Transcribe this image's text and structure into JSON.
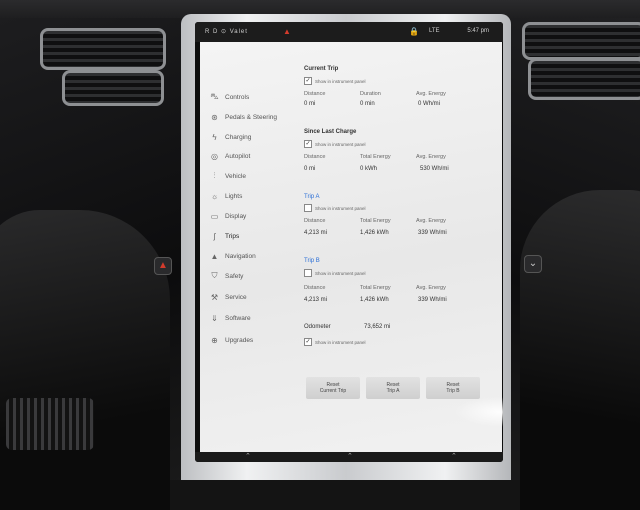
{
  "status_bar": {
    "left_text": "R D ⊙ Valet",
    "network": "LTE",
    "time": "5:47 pm"
  },
  "sidebar": {
    "items": [
      {
        "label": "Controls",
        "icon": "car-icon"
      },
      {
        "label": "Pedals & Steering",
        "icon": "steering-wheel-icon"
      },
      {
        "label": "Charging",
        "icon": "lightning-icon"
      },
      {
        "label": "Autopilot",
        "icon": "steering-circle-icon"
      },
      {
        "label": "Vehicle",
        "icon": "sliders-icon"
      },
      {
        "label": "Lights",
        "icon": "sun-icon"
      },
      {
        "label": "Display",
        "icon": "display-icon"
      },
      {
        "label": "Trips",
        "icon": "trips-icon"
      },
      {
        "label": "Navigation",
        "icon": "navigation-arrow-icon"
      },
      {
        "label": "Safety",
        "icon": "shield-icon"
      },
      {
        "label": "Service",
        "icon": "wrench-icon"
      },
      {
        "label": "Software",
        "icon": "download-icon"
      },
      {
        "label": "Upgrades",
        "icon": "upgrade-icon"
      }
    ]
  },
  "current_trip": {
    "title": "Current Trip",
    "show_label": "Show in instrument panel",
    "distance_label": "Distance",
    "distance": "0 mi",
    "duration_label": "Duration",
    "duration": "0 min",
    "energy_label": "Avg. Energy",
    "energy": "0 Wh/mi"
  },
  "since_last_charge": {
    "title": "Since Last Charge",
    "show_label": "Show in instrument panel",
    "distance_label": "Distance",
    "distance": "0 mi",
    "total_energy_label": "Total Energy",
    "total_energy": "0 kWh",
    "avg_energy_label": "Avg. Energy",
    "avg_energy": "530 Wh/mi"
  },
  "trip_a": {
    "title": "Trip A",
    "show_label": "Show in instrument panel",
    "distance_label": "Distance",
    "distance": "4,213 mi",
    "total_energy_label": "Total Energy",
    "total_energy": "1,426 kWh",
    "avg_energy_label": "Avg. Energy",
    "avg_energy": "339 Wh/mi"
  },
  "trip_b": {
    "title": "Trip B",
    "show_label": "Show in instrument panel",
    "distance_label": "Distance",
    "distance": "4,213 mi",
    "total_energy_label": "Total Energy",
    "total_energy": "1,426 kWh",
    "avg_energy_label": "Avg. Energy",
    "avg_energy": "339 Wh/mi"
  },
  "odometer": {
    "label": "Odometer",
    "value": "73,652 mi",
    "show_label": "Show in instrument panel"
  },
  "buttons": {
    "reset_current": "Reset\nCurrent Trip",
    "reset_a": "Reset\nTrip A",
    "reset_b": "Reset\nTrip B"
  },
  "colors": {
    "accent": "#2c6fd6",
    "warning": "#d23b2c"
  }
}
